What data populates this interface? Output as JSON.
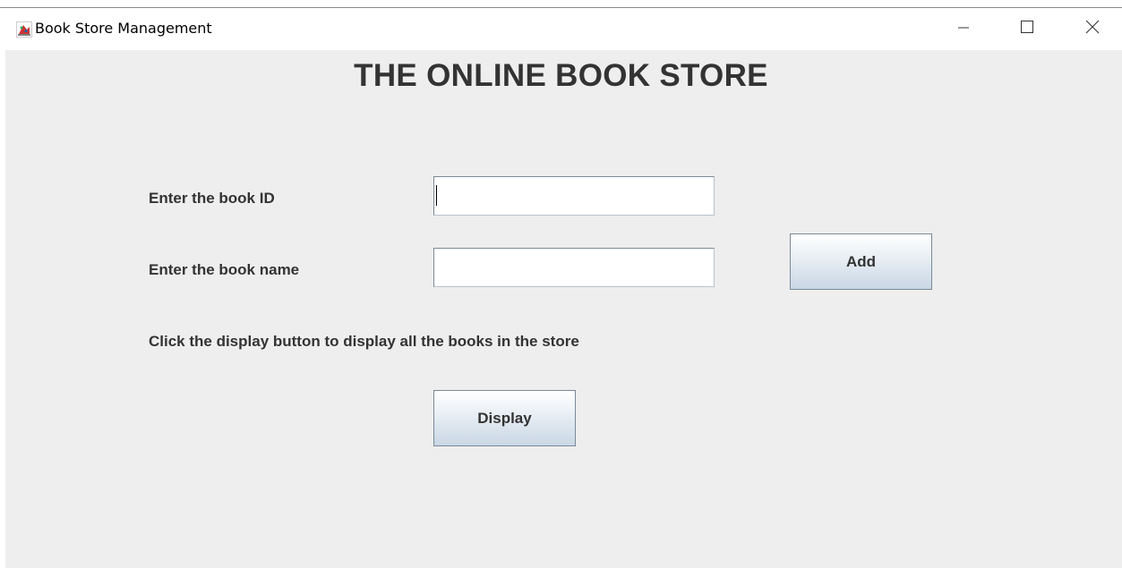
{
  "window": {
    "title": "Book Store Management",
    "icon": "java-cup-icon",
    "controls": {
      "minimize_icon": "minimize-icon",
      "maximize_icon": "maximize-icon",
      "close_icon": "close-icon"
    }
  },
  "main": {
    "heading": "THE ONLINE BOOK STORE",
    "book_id": {
      "label": "Enter the book ID",
      "value": "",
      "placeholder": ""
    },
    "book_name": {
      "label": "Enter the book name",
      "value": "",
      "placeholder": ""
    },
    "add_button_label": "Add",
    "display_instruction": "Click the display button to display all the books in the store",
    "display_button_label": "Display"
  },
  "colors": {
    "background": "#eeeeee",
    "text": "#333333",
    "button_gradient_bottom": "#c9d7e5",
    "field_border": "#7a8a99"
  }
}
